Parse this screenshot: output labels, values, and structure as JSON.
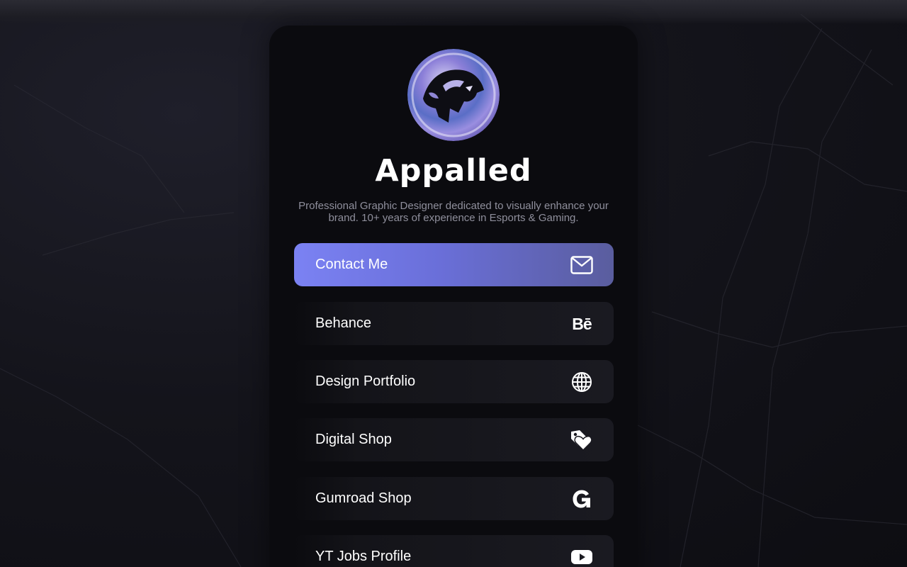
{
  "profile": {
    "name": "Appalled",
    "bio": "Professional Graphic Designer dedicated to visually enhance your brand. 10+ years of experience in Esports & Gaming."
  },
  "links": [
    {
      "label": "Contact Me",
      "icon": "mail-icon",
      "highlighted": true
    },
    {
      "label": "Behance",
      "icon": "behance-icon",
      "icon_text": "Bē"
    },
    {
      "label": "Design Portfolio",
      "icon": "globe-icon"
    },
    {
      "label": "Digital Shop",
      "icon": "price-tag-heart-icon"
    },
    {
      "label": "Gumroad Shop",
      "icon": "gumroad-icon"
    },
    {
      "label": "YT Jobs Profile",
      "icon": "youtube-icon"
    }
  ],
  "colors": {
    "background": "#14141b",
    "card": "#0b0b0f",
    "accent_start": "#7b82f3",
    "accent_end": "#5a5d9e",
    "link_bg": "#1a1a21",
    "bio_text": "#8f8f9c"
  }
}
